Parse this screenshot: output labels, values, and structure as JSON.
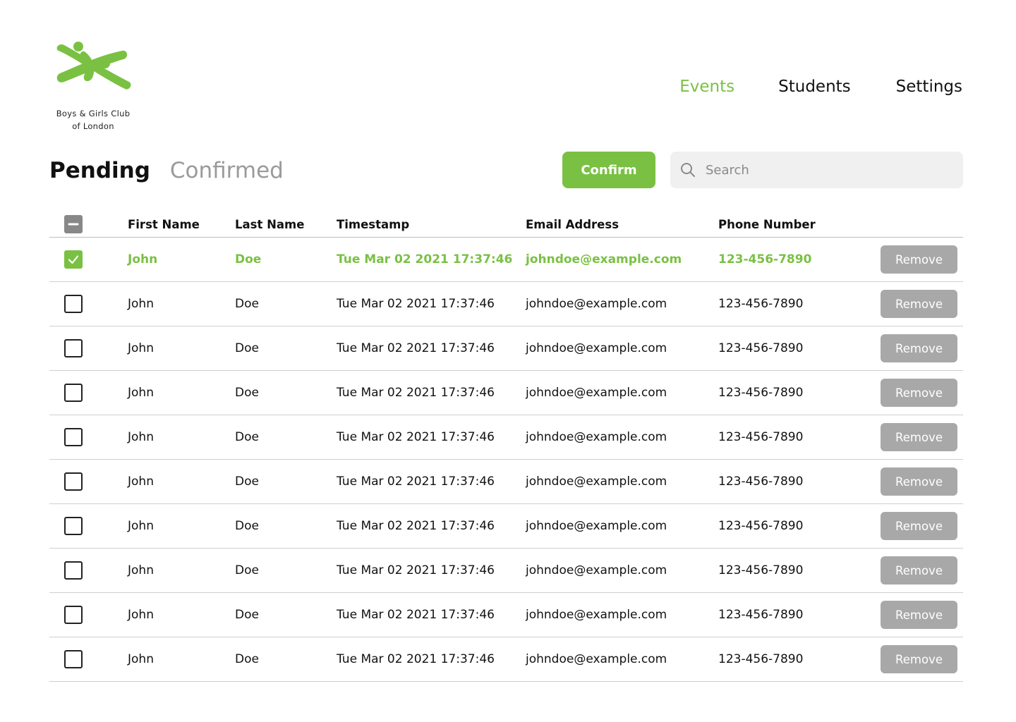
{
  "brand": {
    "name_line1": "Boys & Girls Club",
    "name_line2": "of London",
    "accent_color": "#7ac143"
  },
  "nav": {
    "items": [
      {
        "label": "Events",
        "active": true
      },
      {
        "label": "Students",
        "active": false
      },
      {
        "label": "Settings",
        "active": false
      }
    ]
  },
  "tabs": [
    {
      "label": "Pending",
      "active": true
    },
    {
      "label": "Confirmed",
      "active": false
    }
  ],
  "toolbar": {
    "confirm_label": "Confirm"
  },
  "search": {
    "placeholder": "Search",
    "value": "",
    "icon": "search-icon"
  },
  "table": {
    "columns": [
      "First Name",
      "Last Name",
      "Timestamp",
      "Email Address",
      "Phone Number"
    ],
    "select_all_state": "indeterminate",
    "remove_label": "Remove",
    "rows": [
      {
        "selected": true,
        "first": "John",
        "last": "Doe",
        "timestamp": "Tue Mar 02 2021 17:37:46",
        "email": "johndoe@example.com",
        "phone": "123-456-7890"
      },
      {
        "selected": false,
        "first": "John",
        "last": "Doe",
        "timestamp": "Tue Mar 02 2021 17:37:46",
        "email": "johndoe@example.com",
        "phone": "123-456-7890"
      },
      {
        "selected": false,
        "first": "John",
        "last": "Doe",
        "timestamp": "Tue Mar 02 2021 17:37:46",
        "email": "johndoe@example.com",
        "phone": "123-456-7890"
      },
      {
        "selected": false,
        "first": "John",
        "last": "Doe",
        "timestamp": "Tue Mar 02 2021 17:37:46",
        "email": "johndoe@example.com",
        "phone": "123-456-7890"
      },
      {
        "selected": false,
        "first": "John",
        "last": "Doe",
        "timestamp": "Tue Mar 02 2021 17:37:46",
        "email": "johndoe@example.com",
        "phone": "123-456-7890"
      },
      {
        "selected": false,
        "first": "John",
        "last": "Doe",
        "timestamp": "Tue Mar 02 2021 17:37:46",
        "email": "johndoe@example.com",
        "phone": "123-456-7890"
      },
      {
        "selected": false,
        "first": "John",
        "last": "Doe",
        "timestamp": "Tue Mar 02 2021 17:37:46",
        "email": "johndoe@example.com",
        "phone": "123-456-7890"
      },
      {
        "selected": false,
        "first": "John",
        "last": "Doe",
        "timestamp": "Tue Mar 02 2021 17:37:46",
        "email": "johndoe@example.com",
        "phone": "123-456-7890"
      },
      {
        "selected": false,
        "first": "John",
        "last": "Doe",
        "timestamp": "Tue Mar 02 2021 17:37:46",
        "email": "johndoe@example.com",
        "phone": "123-456-7890"
      },
      {
        "selected": false,
        "first": "John",
        "last": "Doe",
        "timestamp": "Tue Mar 02 2021 17:37:46",
        "email": "johndoe@example.com",
        "phone": "123-456-7890"
      }
    ]
  }
}
